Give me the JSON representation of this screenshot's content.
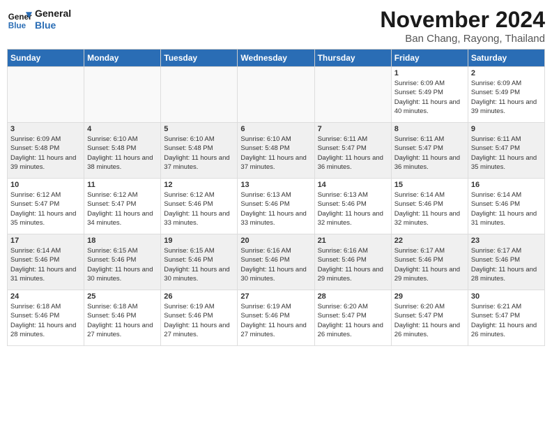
{
  "logo": {
    "text_general": "General",
    "text_blue": "Blue"
  },
  "header": {
    "title": "November 2024",
    "subtitle": "Ban Chang, Rayong, Thailand"
  },
  "days_of_week": [
    "Sunday",
    "Monday",
    "Tuesday",
    "Wednesday",
    "Thursday",
    "Friday",
    "Saturday"
  ],
  "weeks": [
    {
      "days": [
        {
          "num": "",
          "empty": true
        },
        {
          "num": "",
          "empty": true
        },
        {
          "num": "",
          "empty": true
        },
        {
          "num": "",
          "empty": true
        },
        {
          "num": "",
          "empty": true
        },
        {
          "num": "1",
          "sunrise": "Sunrise: 6:09 AM",
          "sunset": "Sunset: 5:49 PM",
          "daylight": "Daylight: 11 hours and 40 minutes."
        },
        {
          "num": "2",
          "sunrise": "Sunrise: 6:09 AM",
          "sunset": "Sunset: 5:49 PM",
          "daylight": "Daylight: 11 hours and 39 minutes."
        }
      ]
    },
    {
      "days": [
        {
          "num": "3",
          "sunrise": "Sunrise: 6:09 AM",
          "sunset": "Sunset: 5:48 PM",
          "daylight": "Daylight: 11 hours and 39 minutes."
        },
        {
          "num": "4",
          "sunrise": "Sunrise: 6:10 AM",
          "sunset": "Sunset: 5:48 PM",
          "daylight": "Daylight: 11 hours and 38 minutes."
        },
        {
          "num": "5",
          "sunrise": "Sunrise: 6:10 AM",
          "sunset": "Sunset: 5:48 PM",
          "daylight": "Daylight: 11 hours and 37 minutes."
        },
        {
          "num": "6",
          "sunrise": "Sunrise: 6:10 AM",
          "sunset": "Sunset: 5:48 PM",
          "daylight": "Daylight: 11 hours and 37 minutes."
        },
        {
          "num": "7",
          "sunrise": "Sunrise: 6:11 AM",
          "sunset": "Sunset: 5:47 PM",
          "daylight": "Daylight: 11 hours and 36 minutes."
        },
        {
          "num": "8",
          "sunrise": "Sunrise: 6:11 AM",
          "sunset": "Sunset: 5:47 PM",
          "daylight": "Daylight: 11 hours and 36 minutes."
        },
        {
          "num": "9",
          "sunrise": "Sunrise: 6:11 AM",
          "sunset": "Sunset: 5:47 PM",
          "daylight": "Daylight: 11 hours and 35 minutes."
        }
      ]
    },
    {
      "days": [
        {
          "num": "10",
          "sunrise": "Sunrise: 6:12 AM",
          "sunset": "Sunset: 5:47 PM",
          "daylight": "Daylight: 11 hours and 35 minutes."
        },
        {
          "num": "11",
          "sunrise": "Sunrise: 6:12 AM",
          "sunset": "Sunset: 5:47 PM",
          "daylight": "Daylight: 11 hours and 34 minutes."
        },
        {
          "num": "12",
          "sunrise": "Sunrise: 6:12 AM",
          "sunset": "Sunset: 5:46 PM",
          "daylight": "Daylight: 11 hours and 33 minutes."
        },
        {
          "num": "13",
          "sunrise": "Sunrise: 6:13 AM",
          "sunset": "Sunset: 5:46 PM",
          "daylight": "Daylight: 11 hours and 33 minutes."
        },
        {
          "num": "14",
          "sunrise": "Sunrise: 6:13 AM",
          "sunset": "Sunset: 5:46 PM",
          "daylight": "Daylight: 11 hours and 32 minutes."
        },
        {
          "num": "15",
          "sunrise": "Sunrise: 6:14 AM",
          "sunset": "Sunset: 5:46 PM",
          "daylight": "Daylight: 11 hours and 32 minutes."
        },
        {
          "num": "16",
          "sunrise": "Sunrise: 6:14 AM",
          "sunset": "Sunset: 5:46 PM",
          "daylight": "Daylight: 11 hours and 31 minutes."
        }
      ]
    },
    {
      "days": [
        {
          "num": "17",
          "sunrise": "Sunrise: 6:14 AM",
          "sunset": "Sunset: 5:46 PM",
          "daylight": "Daylight: 11 hours and 31 minutes."
        },
        {
          "num": "18",
          "sunrise": "Sunrise: 6:15 AM",
          "sunset": "Sunset: 5:46 PM",
          "daylight": "Daylight: 11 hours and 30 minutes."
        },
        {
          "num": "19",
          "sunrise": "Sunrise: 6:15 AM",
          "sunset": "Sunset: 5:46 PM",
          "daylight": "Daylight: 11 hours and 30 minutes."
        },
        {
          "num": "20",
          "sunrise": "Sunrise: 6:16 AM",
          "sunset": "Sunset: 5:46 PM",
          "daylight": "Daylight: 11 hours and 30 minutes."
        },
        {
          "num": "21",
          "sunrise": "Sunrise: 6:16 AM",
          "sunset": "Sunset: 5:46 PM",
          "daylight": "Daylight: 11 hours and 29 minutes."
        },
        {
          "num": "22",
          "sunrise": "Sunrise: 6:17 AM",
          "sunset": "Sunset: 5:46 PM",
          "daylight": "Daylight: 11 hours and 29 minutes."
        },
        {
          "num": "23",
          "sunrise": "Sunrise: 6:17 AM",
          "sunset": "Sunset: 5:46 PM",
          "daylight": "Daylight: 11 hours and 28 minutes."
        }
      ]
    },
    {
      "days": [
        {
          "num": "24",
          "sunrise": "Sunrise: 6:18 AM",
          "sunset": "Sunset: 5:46 PM",
          "daylight": "Daylight: 11 hours and 28 minutes."
        },
        {
          "num": "25",
          "sunrise": "Sunrise: 6:18 AM",
          "sunset": "Sunset: 5:46 PM",
          "daylight": "Daylight: 11 hours and 27 minutes."
        },
        {
          "num": "26",
          "sunrise": "Sunrise: 6:19 AM",
          "sunset": "Sunset: 5:46 PM",
          "daylight": "Daylight: 11 hours and 27 minutes."
        },
        {
          "num": "27",
          "sunrise": "Sunrise: 6:19 AM",
          "sunset": "Sunset: 5:46 PM",
          "daylight": "Daylight: 11 hours and 27 minutes."
        },
        {
          "num": "28",
          "sunrise": "Sunrise: 6:20 AM",
          "sunset": "Sunset: 5:47 PM",
          "daylight": "Daylight: 11 hours and 26 minutes."
        },
        {
          "num": "29",
          "sunrise": "Sunrise: 6:20 AM",
          "sunset": "Sunset: 5:47 PM",
          "daylight": "Daylight: 11 hours and 26 minutes."
        },
        {
          "num": "30",
          "sunrise": "Sunrise: 6:21 AM",
          "sunset": "Sunset: 5:47 PM",
          "daylight": "Daylight: 11 hours and 26 minutes."
        }
      ]
    }
  ]
}
